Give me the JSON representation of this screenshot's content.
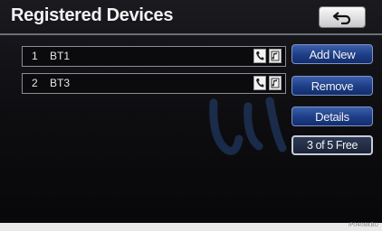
{
  "screen": {
    "title": "Registered Devices"
  },
  "back": {
    "icon": "return-arrow-icon"
  },
  "devices": [
    {
      "number": "1",
      "name": "BT1",
      "icons": [
        "phone-icon",
        "audio-player-icon"
      ]
    },
    {
      "number": "2",
      "name": "BT3",
      "icons": [
        "phone-icon",
        "audio-player-icon"
      ]
    }
  ],
  "actions": {
    "add_new": "Add New",
    "remove": "Remove",
    "details": "Details"
  },
  "status": {
    "free_slots": "3 of 5 Free"
  },
  "footer": {
    "code": "IP0408KBU"
  },
  "colors": {
    "accent_blue": "#1d3d86",
    "background": "#0d0d10",
    "watermark": "#3f7be0"
  }
}
